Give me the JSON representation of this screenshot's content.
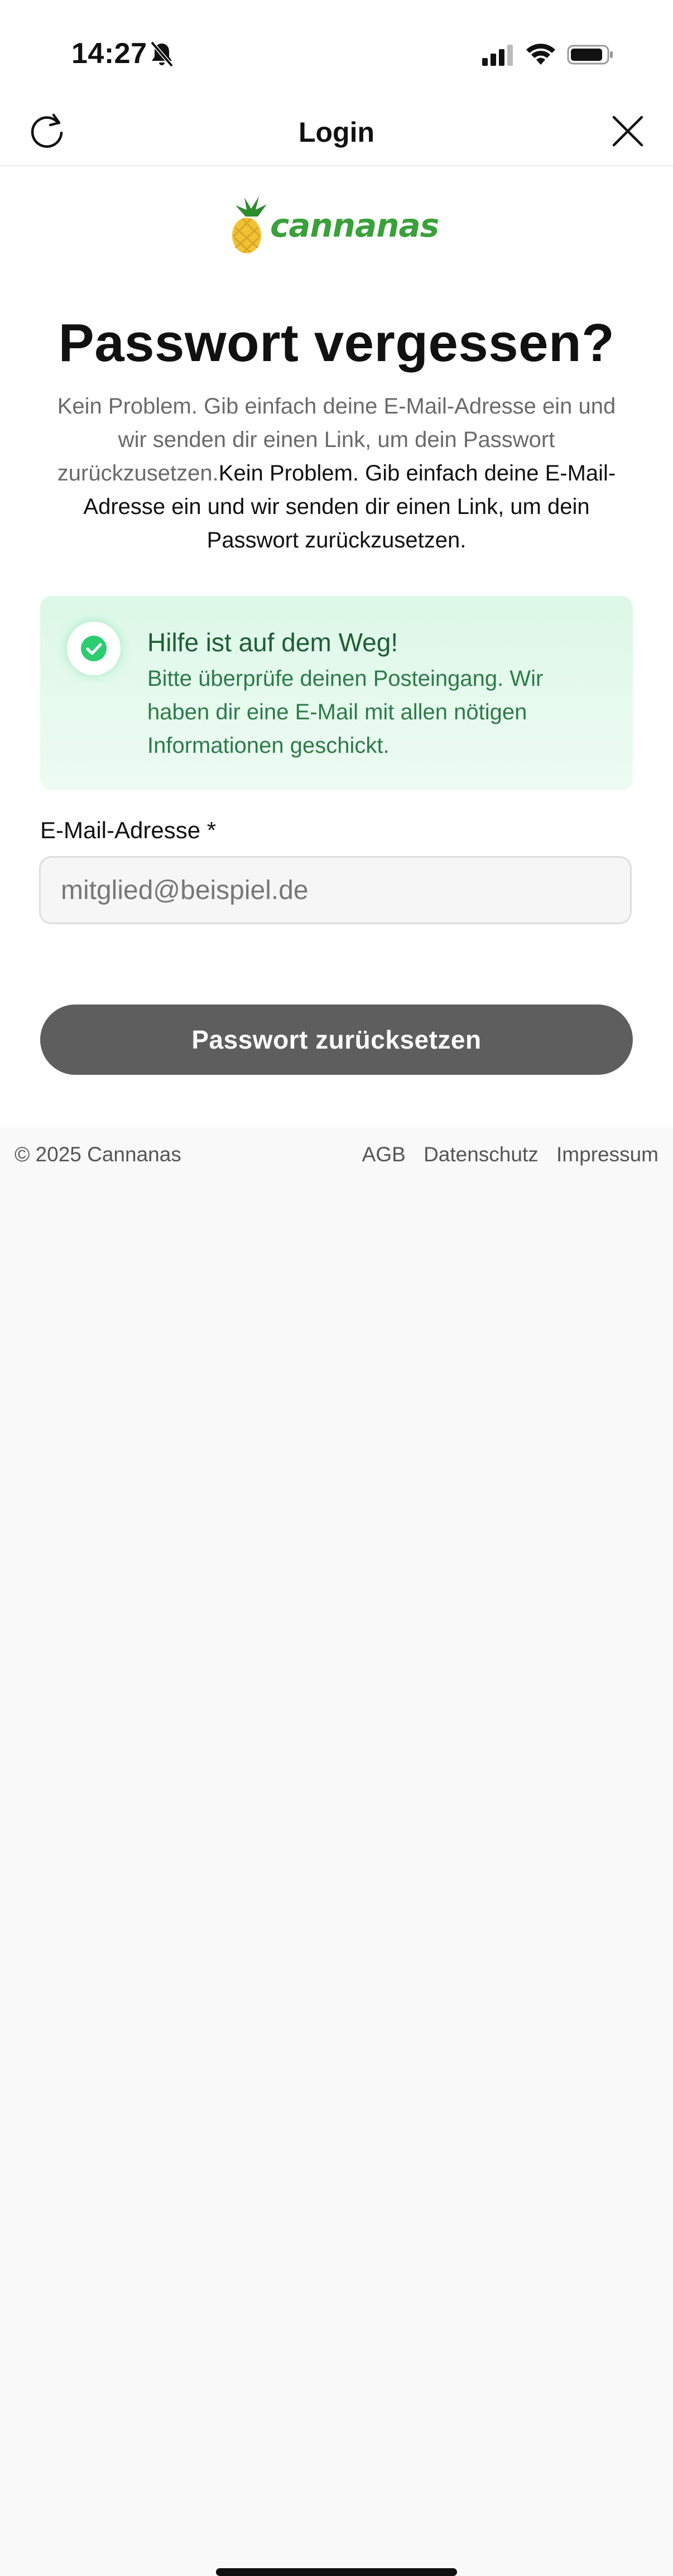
{
  "status_bar": {
    "time": "14:27"
  },
  "nav": {
    "title": "Login"
  },
  "brand": {
    "logo_text": "cannanas",
    "colors": {
      "green": "#3aa13a",
      "pineapple": "#f1c232",
      "leaves": "#2e8b2e"
    }
  },
  "main": {
    "heading": "Passwort vergessen?",
    "intro_light": "Kein Problem. Gib einfach deine E-Mail-Adresse ein und wir senden dir einen Link, um dein Passwort zurückzusetzen.",
    "intro_strong": "Kein Problem. Gib einfach deine E-Mail-Adresse ein und wir senden dir einen Link, um dein Passwort zurückzusetzen."
  },
  "success": {
    "title": "Hilfe ist auf dem Weg!",
    "message": "Bitte überprüfe deinen Posteingang. Wir haben dir eine E-Mail mit allen nötigen Informationen geschickt.",
    "icon": "check-circle-icon",
    "color": "#2ecc71"
  },
  "form": {
    "email_label": "E-Mail-Adresse *",
    "email_placeholder": "mitglied@beispiel.de",
    "email_value": "",
    "submit_label": "Passwort zurücksetzen"
  },
  "footer": {
    "copyright": "© 2025 Cannanas",
    "links": [
      "AGB",
      "Datenschutz",
      "Impressum"
    ]
  }
}
